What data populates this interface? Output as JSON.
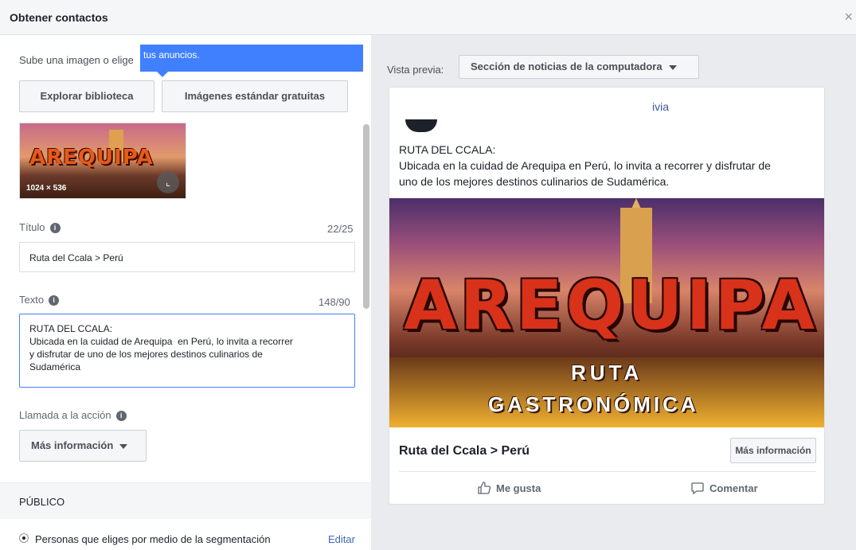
{
  "dialog": {
    "title": "Obtener contactos",
    "close": "×"
  },
  "left": {
    "upload_text": "Sube una imagen o elige",
    "tooltip_text": "tus anuncios.",
    "explorar_label": "Explorar biblioteca",
    "estandar_label": "Imágenes estándar gratuitas",
    "thumbnail": {
      "dims": "1024 × 536"
    },
    "titulo": {
      "label": "Título",
      "counter": "22/25",
      "value": "Ruta del Ccala > Perú"
    },
    "texto": {
      "label": "Texto",
      "counter": "148/90",
      "value": "RUTA DEL CCALA:\nUbicada en la cuidad de Arequipa  en Perú, lo invita a recorrer\ny disfrutar de uno de los mejores destinos culinarios de\nSudamérica"
    },
    "cta": {
      "label": "Llamada a la acción",
      "value": "Más información"
    },
    "publico": {
      "heading": "PÚBLICO",
      "option": "Personas que eliges por medio de la segmentación",
      "edit": "Editar"
    }
  },
  "preview": {
    "label": "Vista previa:",
    "selected": "Sección de noticias de la computadora",
    "card": {
      "page_name_fragment": "ivia",
      "text": "RUTA DEL CCALA:\nUbicada en la cuidad de Arequipa en Perú, lo invita a recorrer y disfrutar de\nuno de los mejores destinos culinarios de Sudamérica.",
      "image_word": "AREQUIPA",
      "image_sub1": "RUTA",
      "image_sub2": "GASTRONÓMICA",
      "thumb_word": "AREQUIPA",
      "headline": "Ruta del Ccala > Perú",
      "cta": "Más información",
      "like": "Me gusta",
      "comment": "Comentar"
    }
  },
  "colors": {
    "accent": "#4080ff",
    "link": "#4267b2",
    "panel_bg": "#e9ebee"
  }
}
